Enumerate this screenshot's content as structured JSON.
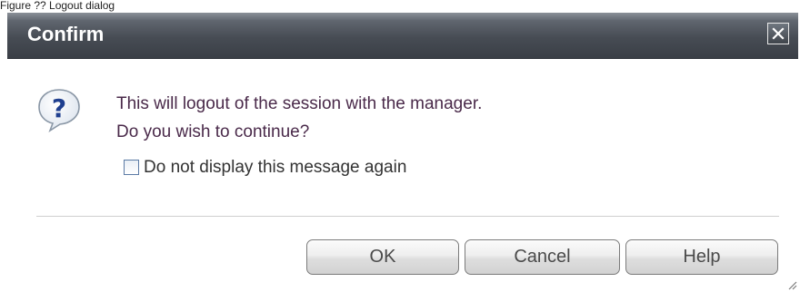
{
  "header_caption": "Figure ?? Logout dialog",
  "dialog": {
    "title": "Confirm",
    "close_label": "close",
    "message_line1": "This will logout of the session with the manager.",
    "message_line2": "Do you wish to continue?",
    "checkbox_label": "Do not display this message again",
    "checkbox_checked": false,
    "buttons": {
      "ok": "OK",
      "cancel": "Cancel",
      "help": "Help"
    }
  },
  "icons": {
    "question": "question-icon",
    "close": "close-icon",
    "resize_grip": "resize-grip-icon"
  },
  "colors": {
    "titlebar": "#474c54",
    "message_text": "#4a2a4a",
    "question_icon": "#1f3f8f"
  }
}
